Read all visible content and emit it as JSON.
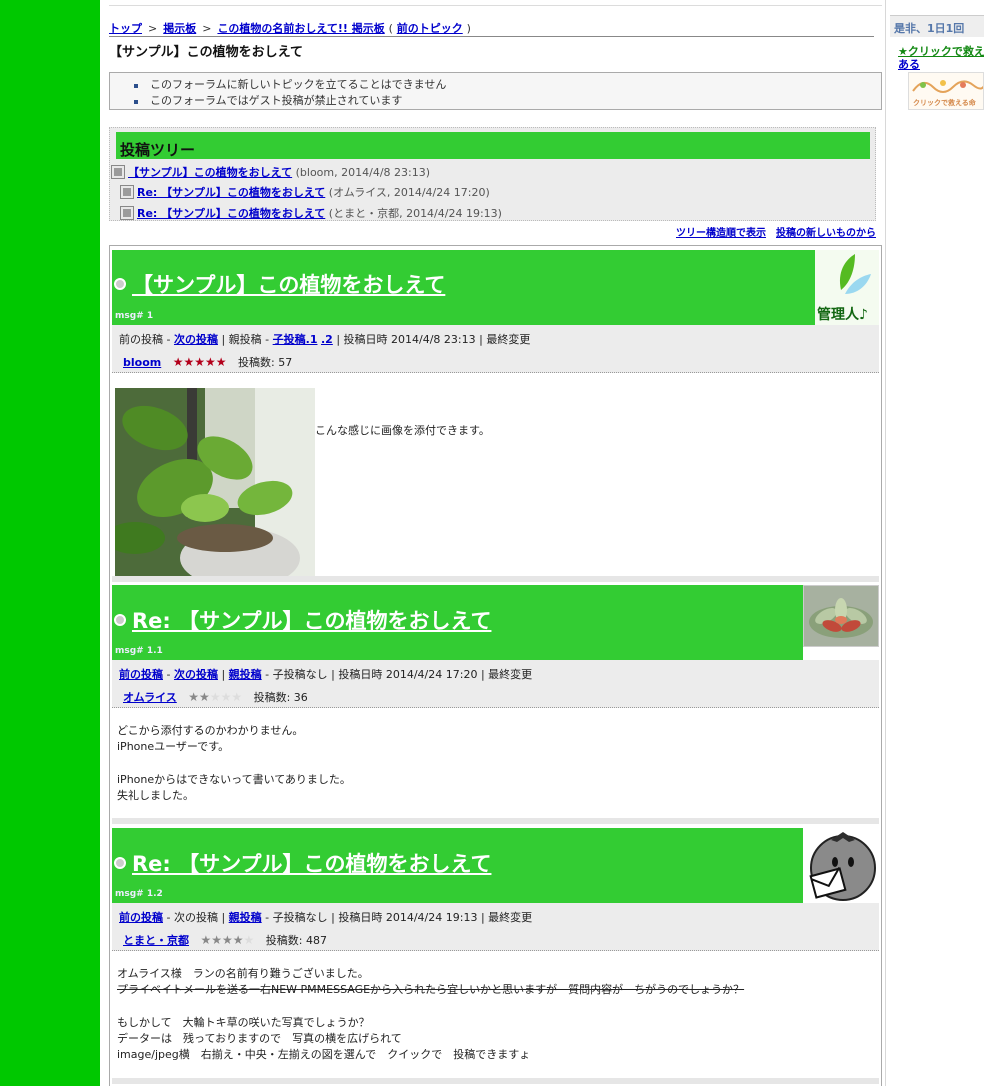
{
  "breadcrumb": {
    "top": "トップ",
    "board": "掲示板",
    "forum": "この植物の名前おしえて!! 掲示板",
    "prev_topic": "前のトピック",
    "sep": ">",
    "paren_open": "(",
    "paren_close": ")"
  },
  "page_title": "【サンプル】この植物をおしえて",
  "notices": [
    "このフォーラムに新しいトピックを立てることはできません",
    "このフォーラムではゲスト投稿が禁止されています"
  ],
  "tree": {
    "heading": "投稿ツリー",
    "rows": [
      {
        "title": "【サンプル】この植物をおしえて",
        "info": "(bloom, 2014/4/8 23:13)"
      },
      {
        "title": "Re: 【サンプル】この植物をおしえて",
        "info": "(オムライス, 2014/4/24 17:20)"
      },
      {
        "title": "Re: 【サンプル】この植物をおしえて",
        "info": "(とまと・京都, 2014/4/24 19:13)"
      }
    ],
    "link_threaded": "ツリー構造順で表示",
    "link_newest": "投稿の新しいものから"
  },
  "posts": [
    {
      "title": "【サンプル】この植物をおしえて",
      "msg": "msg# 1",
      "prev": "前の投稿",
      "next": "次の投稿",
      "parent": "親投稿",
      "children_label": "子投稿",
      "child1": "子投稿.1",
      "child2": ".2",
      "date": "投稿日時 2014/4/8 23:13",
      "last_edit": "最終変更",
      "author": "bloom",
      "stars": 5,
      "count": "投稿数: 57",
      "avatar_text": "管理人♪",
      "body": "こんな感じに画像を添付できます。"
    },
    {
      "title": "Re: 【サンプル】この植物をおしえて",
      "msg": "msg# 1.1",
      "prev": "前の投稿",
      "next": "次の投稿",
      "parent": "親投稿",
      "children_none": "子投稿なし",
      "date": "投稿日時 2014/4/24 17:20",
      "last_edit": "最終変更",
      "author": "オムライス",
      "stars": 2,
      "count": "投稿数: 36",
      "body_lines": [
        "どこから添付するのかわかりません。",
        "iPhoneユーザーです。",
        "",
        "iPhoneからはできないって書いてありました。",
        "失礼しました。"
      ]
    },
    {
      "title": "Re: 【サンプル】この植物をおしえて",
      "msg": "msg# 1.2",
      "prev": "前の投稿",
      "next": "次の投稿",
      "parent": "親投稿",
      "children_none": "子投稿なし",
      "date": "投稿日時 2014/4/24 19:13",
      "last_edit": "最終変更",
      "author": "とまと・京都",
      "stars": 4,
      "count": "投稿数: 487",
      "body_line1": "オムライス様　ランの名前有り難うございました。",
      "body_strike": "プライベイトメールを送る一右NEW PMMESSAGEから入られたら宜しいかと思いますが　質問内容が　ちがうのでしょうか？",
      "body_lines_after": [
        "もしかして　大輪トキ草の咲いた写真でしょうか？",
        "データーは　残っておりますので　写真の横を広げられて",
        "image/jpeg横　右揃え・中央・左揃えの図を選んで　クイックで　投稿できますょ"
      ]
    }
  ],
  "sidebar": {
    "heading": "是非、1日1回",
    "link_green": "★クリックで救え",
    "link_blue": "ある",
    "banner_text": "クリックで救える命"
  },
  "colors": {
    "left_band": "#00c800",
    "post_header": "#33cc33",
    "link": "#0000cc"
  }
}
